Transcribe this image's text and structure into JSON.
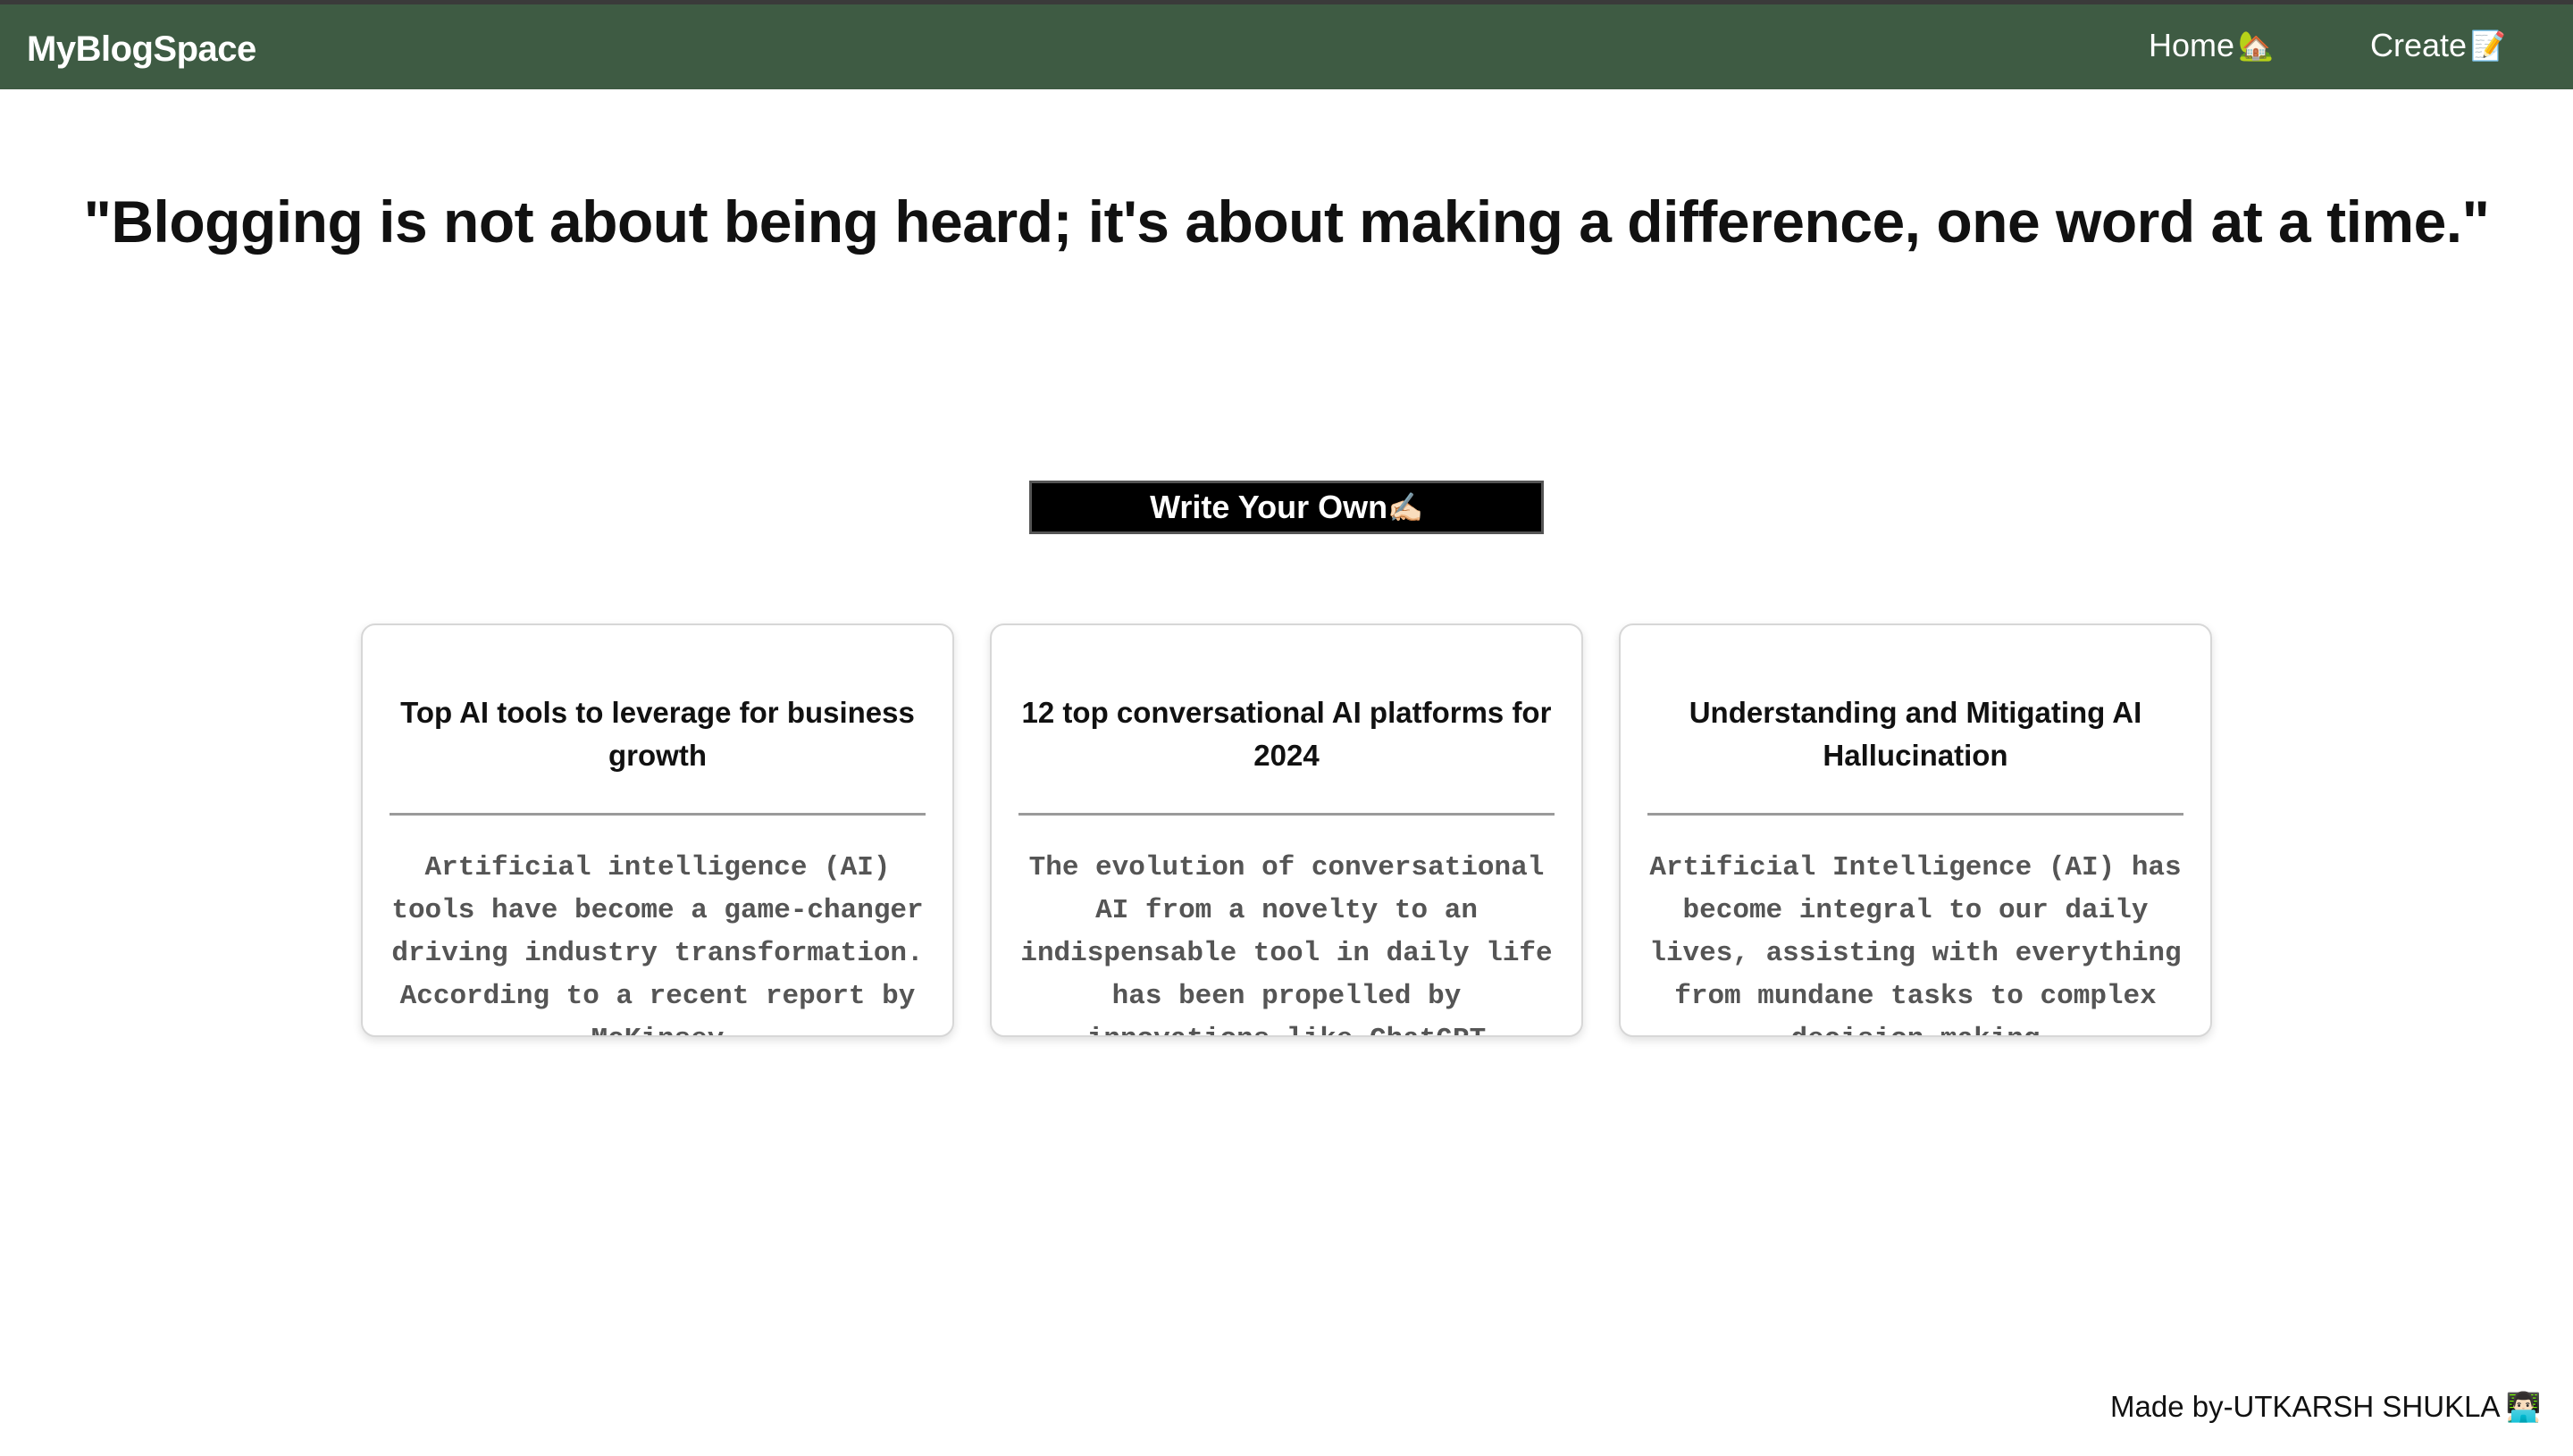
{
  "navbar": {
    "brand": "MyBlogSpace",
    "home_label": "Home",
    "home_icon": "🏡",
    "create_label": "Create",
    "create_icon": "📝",
    "background": "#3e5b43"
  },
  "hero": {
    "quote": "\"Blogging is not about being heard; it's about making a difference, one word at a time.\""
  },
  "cta": {
    "label": "Write Your Own",
    "icon": "✍🏻"
  },
  "cards": [
    {
      "title": "Top AI tools to leverage for business growth",
      "excerpt": "Artificial intelligence (AI) tools have become a game-changer driving industry transformation. According to a recent report by McKinsey"
    },
    {
      "title": "12 top conversational AI platforms for 2024",
      "excerpt": "The evolution of conversational AI from a novelty to an indispensable tool in daily life has been propelled by innovations like ChatGPT"
    },
    {
      "title": "Understanding and Mitigating AI Hallucination",
      "excerpt": "Artificial Intelligence (AI) has become integral to our daily lives, assisting with everything from mundane tasks to complex decision-making"
    }
  ],
  "footer": {
    "text": "Made by-UTKARSH SHUKLA",
    "icon": "👨🏻‍💻"
  }
}
